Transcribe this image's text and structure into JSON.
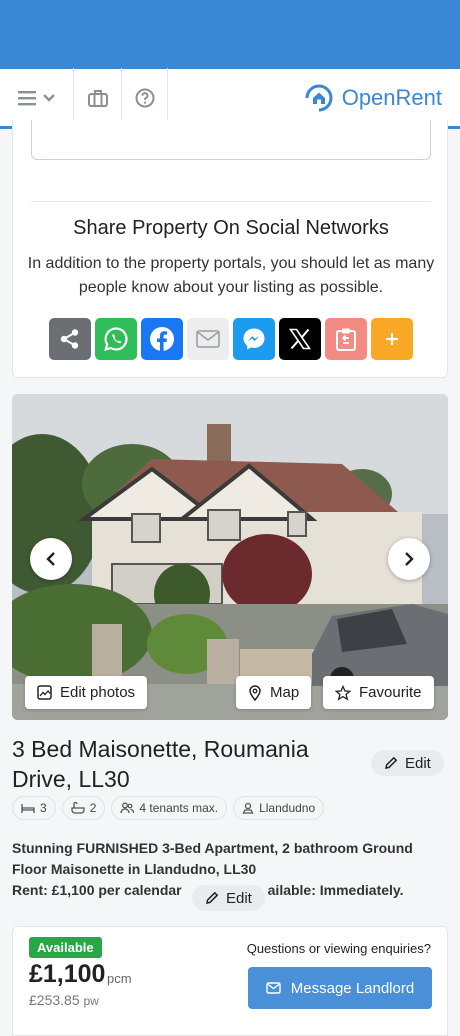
{
  "app": {
    "brand": "OpenRent"
  },
  "share": {
    "title": "Share Property On Social Networks",
    "subtitle": "In addition to the property portals, you should let as many people know about your listing as possible.",
    "buttons": [
      {
        "name": "share-icon",
        "color": "#6b6e72"
      },
      {
        "name": "whatsapp-icon",
        "color": "#2ebd59"
      },
      {
        "name": "facebook-icon",
        "color": "#1877f2"
      },
      {
        "name": "email-icon",
        "color": "#ededed"
      },
      {
        "name": "messenger-icon",
        "color": "#1d9bf0"
      },
      {
        "name": "x-icon",
        "color": "#000000"
      },
      {
        "name": "clipboard-icon",
        "color": "#f28b82"
      },
      {
        "name": "more-icon",
        "color": "#f9a825"
      }
    ]
  },
  "photo": {
    "edit_photos": "Edit photos",
    "map": "Map",
    "favourite": "Favourite"
  },
  "listing": {
    "title": "3 Bed Maisonette, Roumania Drive, LL30",
    "edit": "Edit",
    "features": {
      "beds": "3",
      "baths": "2",
      "tenants": "4 tenants max.",
      "location": "Llandudno"
    },
    "description_line1": "Stunning FURNISHED 3-Bed Apartment, 2 bathroom Ground Floor Maisonette in Llandudno, LL30",
    "description_line2_a": "Rent: £1,100 per calendar",
    "description_line2_b": "ailable: Immediately.",
    "desc_edit": "Edit"
  },
  "pricing": {
    "status": "Available",
    "price": "£1,100",
    "period": "pcm",
    "weekly": "£253.85",
    "weekly_period": "pw",
    "enquiries": "Questions or viewing enquiries?",
    "message": "Message Landlord"
  }
}
